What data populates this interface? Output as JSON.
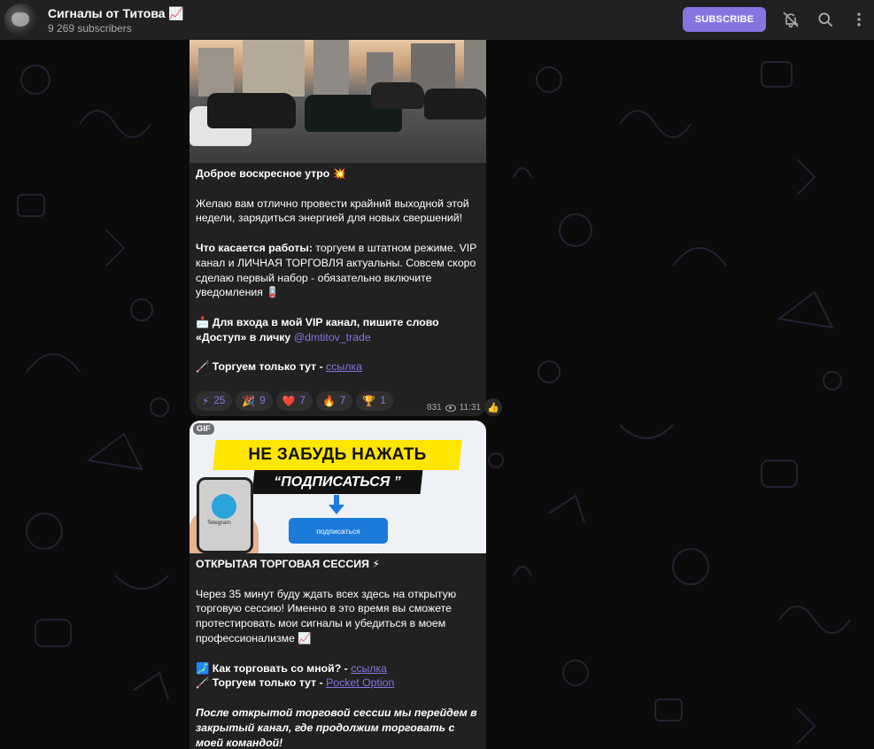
{
  "header": {
    "channel_title": "Сигналы от Титова 📈",
    "subscribers": "9 269 subscribers",
    "subscribe_label": "SUBSCRIBE"
  },
  "icons": {
    "mute": "bell-off-icon",
    "search": "search-icon",
    "more": "more-vertical-icon"
  },
  "colors": {
    "accent": "#8774e1",
    "header_bg": "#212121",
    "bubble_bg": "#212121",
    "chat_bg": "#0b0b0b"
  },
  "message1": {
    "title": "Доброе воскресное утро 💥",
    "para1": "Желаю вам отлично провести крайний выходной этой недели, зарядиться энергией для новых свершений!",
    "para2_bold": "Что касается работы:",
    "para2_rest": " торгуем в штатном режиме. VIP канал и ЛИЧНАЯ ТОРГОВЛЯ актуальны. Совсем скоро сделаю первый набор - обязательно включите уведомления 🪫",
    "para3_bold": "📩 Для входа в мой VIP канал, пишите слово «Доступ» в личку",
    "para3_mention": "@dmtitov_trade",
    "para4_bold": "🦯 Торгуем только тут -",
    "para4_link": "ссылка",
    "reactions": [
      {
        "icon": "⚡",
        "count": "25"
      },
      {
        "icon": "🎉",
        "count": "9"
      },
      {
        "icon": "❤️",
        "count": "7"
      },
      {
        "icon": "🔥",
        "count": "7"
      },
      {
        "icon": "🏆",
        "count": "1"
      }
    ],
    "views": "831",
    "time": "11:31",
    "side_reaction": "👍"
  },
  "message2": {
    "gif_badge": "GIF",
    "banner_line1": "НЕ ЗАБУДЬ НАЖАТЬ",
    "banner_line2": "“ПОДПИСАТЬСЯ ”",
    "banner_button": "подписаться",
    "phone_label": "Telegram",
    "title": "ОТКРЫТАЯ ТОРГОВАЯ СЕССИЯ ⚡",
    "para1": "Через 35 минут буду ждать всех здесь на открытую торговую сессию! Именно в это время вы сможете протестировать мои сигналы и убедиться в моем профессионализме 📈",
    "line_how_bold": "🗾 Как торговать со мной? -",
    "line_how_link": "ссылка",
    "line_trade_bold": "🦯 Торгуем только тут -",
    "line_trade_link": "Pocket Option",
    "para_italic": "После открытой торговой сессии мы перейдем в закрытый канал, где продолжим торговать с моей командой!"
  }
}
